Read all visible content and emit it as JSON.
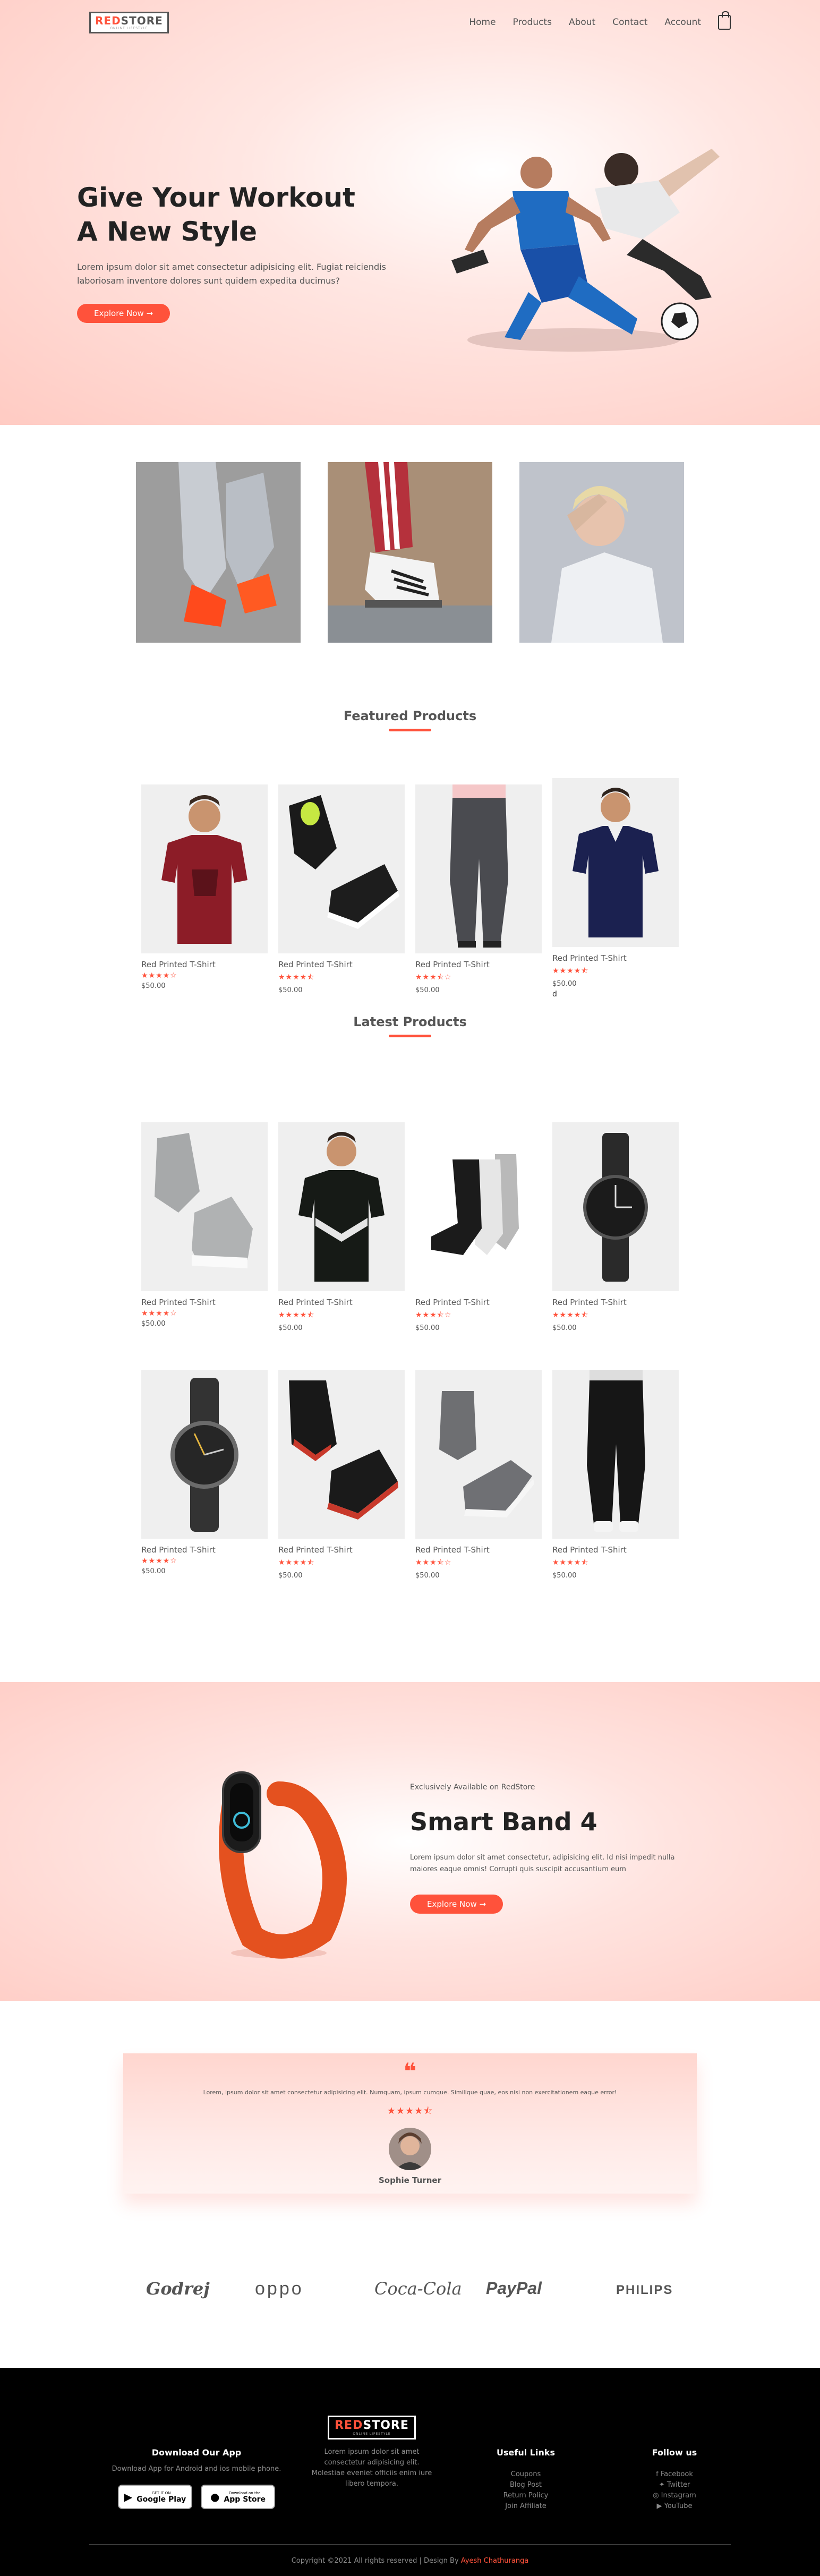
{
  "brand": {
    "logo_red": "RED",
    "logo_dark": "STORE",
    "tagline": "ONLINE LIFESTYLE"
  },
  "nav": {
    "items": [
      "Home",
      "Products",
      "About",
      "Contact",
      "Account"
    ]
  },
  "hero": {
    "title_line1": "Give Your Workout",
    "title_line2": "A New Style",
    "text": "Lorem ipsum dolor sit amet consectetur adipisicing elit. Fugiat reiciendis laboriosam inventore dolores sunt quidem expedita ducimus?",
    "button": "Explore Now →"
  },
  "featured": {
    "title": "Featured Products",
    "products": [
      {
        "name": "Red Printed T-Shirt",
        "stars": "★★★★☆",
        "price": "$50.00"
      },
      {
        "name": "Red Printed T-Shirt",
        "stars": "★★★★⯪",
        "price": "$50.00"
      },
      {
        "name": "Red Printed T-Shirt",
        "stars": "★★★⯪☆",
        "price": "$50.00"
      },
      {
        "name": "Red Printed T-Shirt",
        "stars": "★★★★⯪",
        "price": "$50.00",
        "extra": "d"
      }
    ]
  },
  "latest": {
    "title": "Latest Products",
    "products": [
      {
        "name": "Red Printed T-Shirt",
        "stars": "★★★★☆",
        "price": "$50.00"
      },
      {
        "name": "Red Printed T-Shirt",
        "stars": "★★★★⯪",
        "price": "$50.00"
      },
      {
        "name": "Red Printed T-Shirt",
        "stars": "★★★⯪☆",
        "price": "$50.00"
      },
      {
        "name": "Red Printed T-Shirt",
        "stars": "★★★★⯪",
        "price": "$50.00"
      },
      {
        "name": "Red Printed T-Shirt",
        "stars": "★★★★☆",
        "price": "$50.00"
      },
      {
        "name": "Red Printed T-Shirt",
        "stars": "★★★★⯪",
        "price": "$50.00"
      },
      {
        "name": "Red Printed T-Shirt",
        "stars": "★★★⯪☆",
        "price": "$50.00"
      },
      {
        "name": "Red Printed T-Shirt",
        "stars": "★★★★⯪",
        "price": "$50.00"
      }
    ]
  },
  "offer": {
    "small": "Exclusively Available on RedStore",
    "title": "Smart Band 4",
    "text": "Lorem ipsum dolor sit amet consectetur, adipisicing elit. Id nisi impedit nulla maiores eaque omnis! Corrupti quis suscipit accusantium eum",
    "button": "Explore Now →"
  },
  "testimonial": {
    "quote_mark": "❝",
    "text": "Lorem, ipsum dolor sit amet consectetur adipisicing elit. Numquam, ipsum cumque. Similique quae, eos nisi non exercitationem eaque error!",
    "stars": "★★★★⯪",
    "name": "Sophie Turner"
  },
  "brands": {
    "godrej": "Godrej",
    "oppo": "oppo",
    "cocacola": "Coca-Cola",
    "paypal": "PayPal",
    "philips": "PHILIPS"
  },
  "footer": {
    "download": {
      "title": "Download Our App",
      "text": "Download App for Android and ios mobile phone.",
      "google": {
        "small": "GET IT ON",
        "big": "Google Play"
      },
      "apple": {
        "small": "Download on the",
        "big": "App Store"
      }
    },
    "about": {
      "logo_red": "RED",
      "logo_white": "STORE",
      "tagline": "ONLINE LIFESTYLE",
      "text": "Lorem ipsum dolor sit amet consectetur adipisicing elit. Molestiae eveniet officiis enim iure libero tempora."
    },
    "links": {
      "title": "Useful Links",
      "items": [
        "Coupons",
        "Blog Post",
        "Return Policy",
        "Join Affiliate"
      ]
    },
    "follow": {
      "title": "Follow us",
      "items": [
        "Facebook",
        "Twitter",
        "Instagram",
        "YouTube"
      ]
    },
    "copyright_prefix": "Copyright ©2021 All rights reserved | Design By",
    "copyright_author": "Ayesh Chathuranga"
  },
  "colors": {
    "accent": "#ff523b",
    "text": "#555555",
    "footer_bg": "#000000"
  },
  "icons": [
    "cart-icon",
    "quote-icon",
    "facebook-icon",
    "twitter-icon",
    "instagram-icon",
    "youtube-icon",
    "google-play-icon",
    "apple-icon"
  ]
}
